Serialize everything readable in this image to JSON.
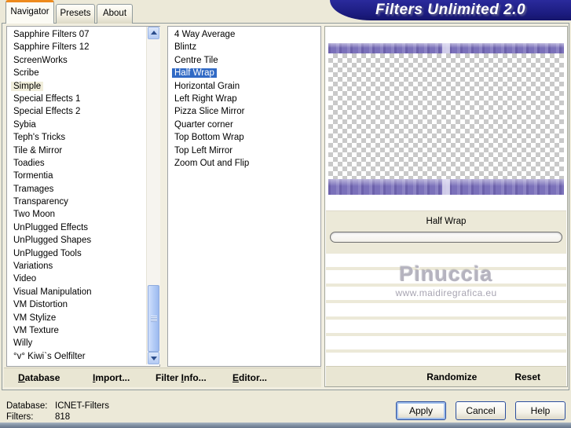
{
  "window": {
    "title": "Filters Unlimited 2.0"
  },
  "tabs": [
    {
      "label": "Navigator",
      "active": true
    },
    {
      "label": "Presets",
      "active": false
    },
    {
      "label": "About",
      "active": false
    }
  ],
  "categories": {
    "items": [
      {
        "label": "Sapphire Filters 07"
      },
      {
        "label": "Sapphire Filters 12"
      },
      {
        "label": "ScreenWorks"
      },
      {
        "label": "Scribe"
      },
      {
        "label": "Simple",
        "selected": true
      },
      {
        "label": "Special Effects 1"
      },
      {
        "label": "Special Effects 2"
      },
      {
        "label": "Sybia"
      },
      {
        "label": "Teph's Tricks"
      },
      {
        "label": "Tile & Mirror"
      },
      {
        "label": "Toadies"
      },
      {
        "label": "Tormentia"
      },
      {
        "label": "Tramages"
      },
      {
        "label": "Transparency"
      },
      {
        "label": "Two Moon"
      },
      {
        "label": "UnPlugged Effects"
      },
      {
        "label": "UnPlugged Shapes"
      },
      {
        "label": "UnPlugged Tools"
      },
      {
        "label": "Variations"
      },
      {
        "label": "Video"
      },
      {
        "label": "Visual Manipulation"
      },
      {
        "label": "VM Distortion"
      },
      {
        "label": "VM Stylize"
      },
      {
        "label": "VM Texture"
      },
      {
        "label": "Willy"
      },
      {
        "label": "°v° Kiwi`s Oelfilter"
      }
    ],
    "selected": "Simple"
  },
  "filters_list": {
    "items": [
      {
        "label": "4 Way Average"
      },
      {
        "label": "Blintz"
      },
      {
        "label": "Centre Tile"
      },
      {
        "label": "Half Wrap",
        "selected": true
      },
      {
        "label": "Horizontal Grain"
      },
      {
        "label": "Left Right Wrap"
      },
      {
        "label": "Pizza Slice Mirror"
      },
      {
        "label": "Quarter corner"
      },
      {
        "label": "Top Bottom Wrap"
      },
      {
        "label": "Top Left Mirror"
      },
      {
        "label": "Zoom Out and Flip"
      }
    ],
    "selected": "Half Wrap"
  },
  "parameter": {
    "name": "Half Wrap",
    "slider_value": 0
  },
  "watermark": {
    "name": "Pinuccia",
    "url": "www.maidiregrafica.eu"
  },
  "toolbar": {
    "buttons": [
      {
        "pre": "",
        "key": "D",
        "post": "atabase"
      },
      {
        "pre": "",
        "key": "I",
        "post": "mport..."
      },
      {
        "pre": "Filter ",
        "key": "I",
        "post": "nfo..."
      },
      {
        "pre": "",
        "key": "E",
        "post": "ditor..."
      }
    ]
  },
  "preview_bar": {
    "randomize": "Randomize",
    "reset": "Reset"
  },
  "status": {
    "db_label": "Database:",
    "db_value": "ICNET-Filters",
    "filters_label": "Filters:",
    "filters_value": "818"
  },
  "dialog_buttons": {
    "apply": "Apply",
    "cancel": "Cancel",
    "help": "Help"
  },
  "colors": {
    "banner_navy": "#1b1b7e",
    "tab_accent_orange": "#ee8a1c",
    "selection_blue": "#316ac5",
    "inactive_selection": "#f1eedb",
    "preview_purple": "#7b71ba",
    "checker_gray": "#c9c9c9",
    "dialog_beige": "#ece9d8"
  }
}
